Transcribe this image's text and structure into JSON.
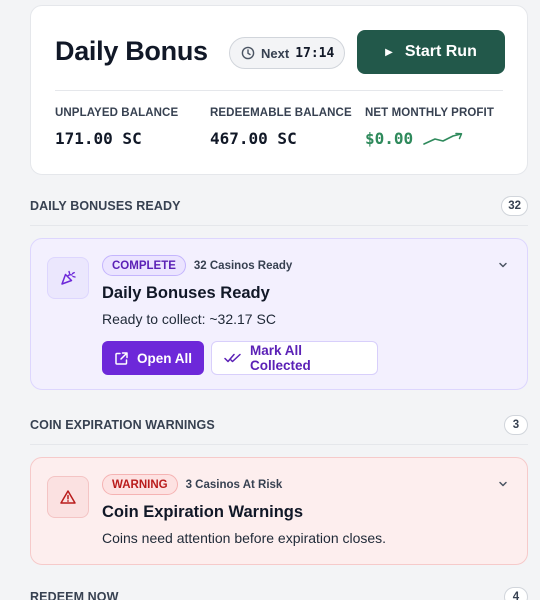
{
  "header": {
    "title": "Daily Bonus",
    "next_label": "Next",
    "next_time": "17:14",
    "start_label": "Start Run",
    "stats": [
      {
        "label": "UNPLAYED BALANCE",
        "value": "171.00 SC"
      },
      {
        "label": "REDEEMABLE BALANCE",
        "value": "467.00 SC"
      },
      {
        "label": "NET MONTHLY PROFIT",
        "value": "$0.00"
      }
    ]
  },
  "sections": [
    {
      "title": "DAILY BONUSES READY",
      "count": "32",
      "card": {
        "tag": "COMPLETE",
        "meta": "32 Casinos Ready",
        "title": "Daily Bonuses Ready",
        "description": "Ready to collect: ~32.17 SC",
        "primary_action": "Open All",
        "secondary_action": "Mark All Collected"
      }
    },
    {
      "title": "COIN EXPIRATION WARNINGS",
      "count": "3",
      "card": {
        "tag": "WARNING",
        "meta": "3 Casinos At Risk",
        "title": "Coin Expiration Warnings",
        "description": "Coins need attention before expiration closes."
      }
    },
    {
      "title": "REDEEM NOW",
      "count": "4"
    }
  ],
  "colors": {
    "brand_green": "#22584a",
    "profit_green": "#2f8a5c",
    "accent_purple": "#6d28d9",
    "warning_red": "#b91c1c"
  }
}
